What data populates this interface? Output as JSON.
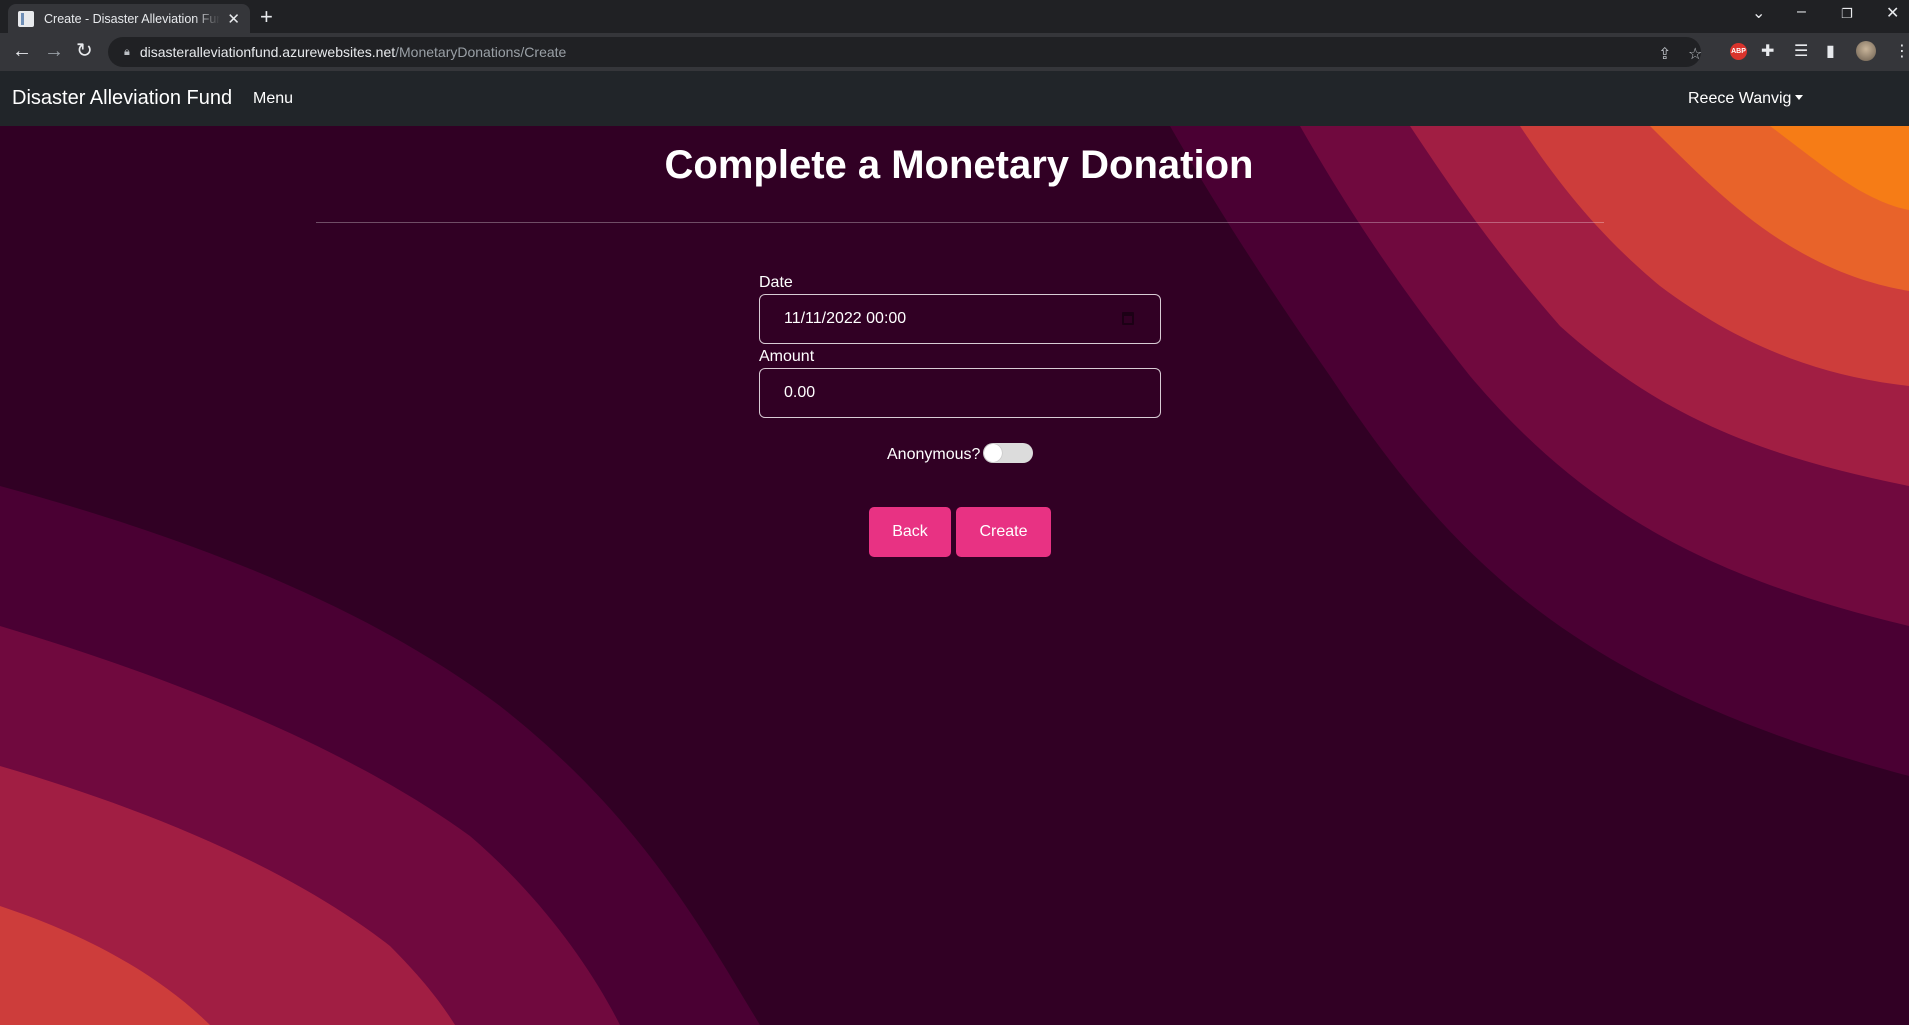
{
  "browser": {
    "tab_title": "Create - Disaster Alleviation Fund",
    "url_host": "disasteralleviationfund.azurewebsites.net",
    "url_path": "/MonetaryDonations/Create",
    "icons": [
      "back-icon",
      "forward-icon",
      "reload-icon",
      "lock-icon",
      "share-icon",
      "star-icon",
      "adblock-icon",
      "extensions-icon",
      "reading-list-icon",
      "side-panel-icon",
      "profile-avatar",
      "more-icon"
    ],
    "abp_label": "ABP"
  },
  "navbar": {
    "brand": "Disaster Alleviation Fund",
    "menu": "Menu",
    "user": "Reece Wanvig"
  },
  "form": {
    "title": "Complete a Monetary Donation",
    "date_label": "Date",
    "date_value": "11/11/2022 00:00",
    "amount_label": "Amount",
    "amount_value": "0.00",
    "anonymous_label": "Anonymous?",
    "anonymous_checked": false,
    "back_button": "Back",
    "create_button": "Create"
  },
  "colors": {
    "background": "#310024",
    "navbar": "#212529",
    "button": "#e83283",
    "wave_1": "#4a0033",
    "wave_2": "#70093e",
    "wave_3": "#a11e43",
    "wave_4": "#cd3d3b",
    "wave_5": "#e8632a",
    "wave_6": "#f67c16"
  }
}
